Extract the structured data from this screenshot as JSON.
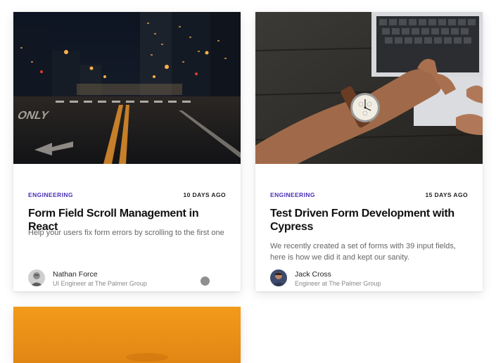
{
  "posts": [
    {
      "category": "ENGINEERING",
      "date": "10 DAYS AGO",
      "title": "Form Field Scroll Management in React",
      "excerpt": "Help your users fix form errors by scrolling to the first one",
      "author": {
        "name": "Nathan Force",
        "role": "UI Engineer at The Palmer Group"
      }
    },
    {
      "category": "ENGINEERING",
      "date": "15 DAYS AGO",
      "title": "Test Driven Form Development with Cypress",
      "excerpt": "We recently created a set of forms with 39 input fields, here is how we did it and kept our sanity.",
      "author": {
        "name": "Jack Cross",
        "role": "Engineer at The Palmer Group"
      }
    }
  ],
  "colors": {
    "category": "#4a2fb7",
    "title": "#111111",
    "excerpt": "#666666",
    "third_card_image": "#f39a1a"
  }
}
